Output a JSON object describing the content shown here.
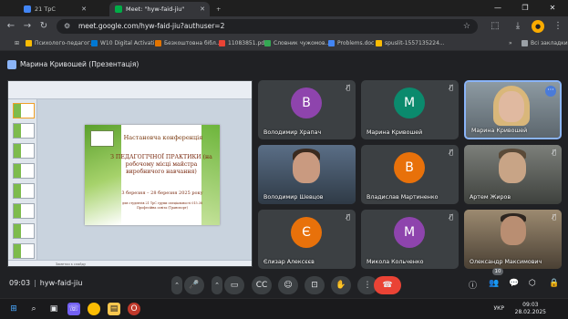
{
  "browser": {
    "tabs": [
      {
        "label": "21 ТрС",
        "favicon_color": "#4285f4",
        "active": false
      },
      {
        "label": "Meet: \"hyw-faid-jiu\"",
        "favicon_color": "#00ac47",
        "active": true
      }
    ],
    "new_tab": "+",
    "url": "meet.google.com/hyw-faid-jiu?authuser=2",
    "bookmarks": [
      {
        "label": "Психолого-педагог...",
        "color": "#fbbc04"
      },
      {
        "label": "W10 Digital Activati...",
        "color": "#0078d4"
      },
      {
        "label": "Безкоштовна бібл...",
        "color": "#e37400"
      },
      {
        "label": "11083851.pdf",
        "color": "#ea4335"
      },
      {
        "label": "Словник чужомов...",
        "color": "#34a853"
      },
      {
        "label": "Problems.doc",
        "color": "#4285f4"
      },
      {
        "label": "spuslit-1557135224...",
        "color": "#fbbc04"
      }
    ],
    "all_bookmarks": "Всі закладки"
  },
  "meet": {
    "presenter_label": "Марина Кривошей (Презентація)",
    "slide": {
      "title": "Настановча конференція",
      "subtitle": "З ПЕДАГОГІЧНОЇ ПРАКТИКИ (на робочому місці майстра виробничого навчання)",
      "dates": "3 березня – 28 березня 2025 року",
      "audience": "для студентів 21 ТрС групи спеціальності 015.38 Професійна освіта (Транспорт)",
      "notes": "Заметки к слайду"
    },
    "participants": [
      {
        "name": "Володимир Храпач",
        "initial": "В",
        "color": "#8e44ad",
        "video": false
      },
      {
        "name": "Марина Кривошей",
        "initial": "М",
        "color": "#0b8a6d",
        "video": false
      },
      {
        "name": "Марина Кривошей",
        "initial": "",
        "color": "",
        "video": true
      },
      {
        "name": "Володимир Шевцов",
        "initial": "",
        "color": "",
        "video": true
      },
      {
        "name": "Владислав Мартиненко",
        "initial": "В",
        "color": "#e8710a",
        "video": false
      },
      {
        "name": "Артем Жиров",
        "initial": "",
        "color": "",
        "video": true
      },
      {
        "name": "Єлизар Алексєєв",
        "initial": "Є",
        "color": "#e8710a",
        "video": false
      },
      {
        "name": "Микола Кольченко",
        "initial": "М",
        "color": "#8e44ad",
        "video": false
      },
      {
        "name": "Олександр Максимович",
        "initial": "",
        "color": "",
        "video": true
      }
    ],
    "time": "09:03",
    "meeting_code": "hyw-faid-jiu",
    "people_count": "10"
  },
  "taskbar": {
    "language": "УКР",
    "time": "09:03",
    "date": "28.02.2025"
  }
}
